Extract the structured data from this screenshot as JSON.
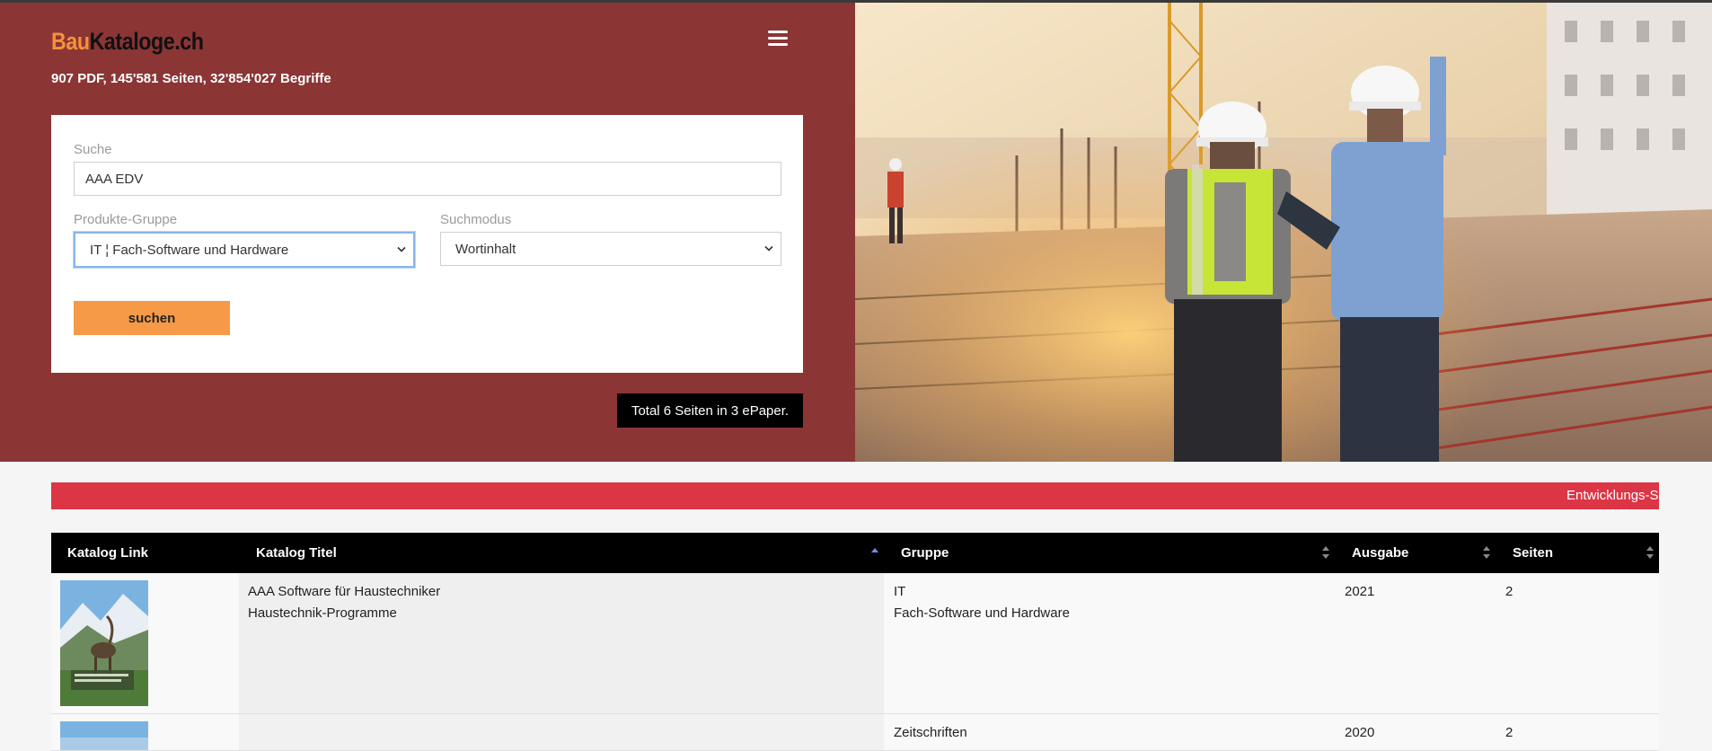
{
  "header": {
    "logo_part1": "Bau",
    "logo_part2": "Kataloge.ch",
    "stats": "907 PDF, 145'581 Seiten, 32'854'027 Begriffe",
    "menu_icon": "hamburger-menu-icon"
  },
  "search": {
    "label": "Suche",
    "value": "AAA EDV",
    "group_label": "Produkte-Gruppe",
    "group_value": "IT ¦ Fach-Software und Hardware",
    "mode_label": "Suchmodus",
    "mode_value": "Wortinhalt",
    "button_label": "suchen"
  },
  "total_badge": "Total 6 Seiten in 3 ePaper.",
  "ticker": {
    "text": "Entwicklungs-S"
  },
  "table": {
    "headers": {
      "link": "Katalog Link",
      "title": "Katalog Titel",
      "group": "Gruppe",
      "edition": "Ausgabe",
      "pages": "Seiten"
    },
    "rows": [
      {
        "title_line1": "AAA Software für Haustechniker",
        "title_line2": "Haustechnik-Programme",
        "group_line1": "IT",
        "group_line2": "Fach-Software und Hardware",
        "edition": "2021",
        "pages": "2"
      },
      {
        "title_line1": "",
        "title_line2": "",
        "group_line1": "Zeitschriften",
        "group_line2": "",
        "edition": "2020",
        "pages": "2"
      }
    ]
  },
  "colors": {
    "hero_bg": "#8b3535",
    "logo_accent": "#f4923a",
    "button": "#f69a48",
    "ticker": "#dc3545",
    "table_header": "#000000"
  }
}
